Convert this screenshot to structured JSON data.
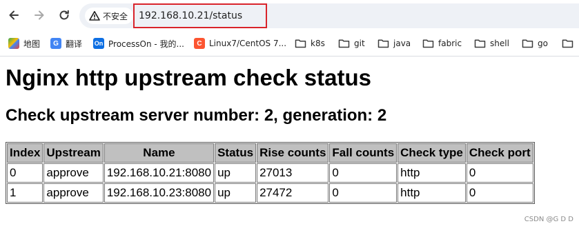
{
  "browser": {
    "security_label": "不安全",
    "url": "192.168.10.21/status",
    "highlight_color": "#d9232a"
  },
  "bookmarks": [
    {
      "label": "地图",
      "icon": "maps-icon"
    },
    {
      "label": "翻译",
      "icon": "translate-icon"
    },
    {
      "label": "ProcessOn - 我的...",
      "icon": "processon-icon"
    },
    {
      "label": "Linux7/CentOS 7...",
      "icon": "csdn-icon"
    },
    {
      "label": "k8s",
      "icon": "folder-icon"
    },
    {
      "label": "git",
      "icon": "folder-icon"
    },
    {
      "label": "java",
      "icon": "folder-icon"
    },
    {
      "label": "fabric",
      "icon": "folder-icon"
    },
    {
      "label": "shell",
      "icon": "folder-icon"
    },
    {
      "label": "go",
      "icon": "folder-icon"
    }
  ],
  "page": {
    "title": "Nginx http upstream check status",
    "subtitle": "Check upstream server number: 2, generation: 2"
  },
  "table": {
    "headers": [
      "Index",
      "Upstream",
      "Name",
      "Status",
      "Rise counts",
      "Fall counts",
      "Check type",
      "Check port"
    ],
    "rows": [
      [
        "0",
        "approve",
        "192.168.10.21:8080",
        "up",
        "27013",
        "0",
        "http",
        "0"
      ],
      [
        "1",
        "approve",
        "192.168.10.23:8080",
        "up",
        "27472",
        "0",
        "http",
        "0"
      ]
    ],
    "header_bg": "#c0c0c0"
  },
  "watermark": "CSDN @G D D"
}
